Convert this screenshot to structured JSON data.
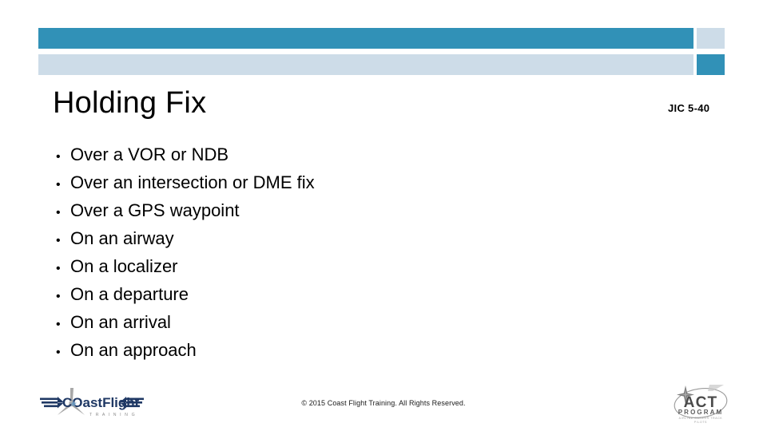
{
  "theme": {
    "teal": "#3191b7",
    "light_blue": "#cddce8",
    "text": "#000000",
    "logo_navy": "#1f3864",
    "logo_gray": "#808080"
  },
  "header": {
    "bars": [
      {
        "name": "teal-long-bar",
        "color": "#3191b7"
      },
      {
        "name": "light-square",
        "color": "#cddce8"
      },
      {
        "name": "light-long-bar",
        "color": "#cddce8"
      },
      {
        "name": "teal-square",
        "color": "#3191b7"
      }
    ]
  },
  "title": "Holding Fix",
  "slide_code": "JIC 5-40",
  "bullets": [
    {
      "marker": "•",
      "text": "Over a VOR or NDB"
    },
    {
      "marker": "•",
      "text": "Over an intersection or DME fix"
    },
    {
      "marker": "•",
      "text": "Over a GPS waypoint"
    },
    {
      "marker": "•",
      "text": "On an airway"
    },
    {
      "marker": "•",
      "text": "On a localizer"
    },
    {
      "marker": "•",
      "text": "On a departure"
    },
    {
      "marker": "•",
      "text": "On an arrival"
    },
    {
      "marker": "•",
      "text": "On an approach"
    }
  ],
  "footer": {
    "copyright": "© 2015 Coast Flight Training. All Rights Reserved."
  },
  "logos": {
    "coastflight": {
      "name": "coastflight-logo",
      "wordmark_coast": "COast",
      "wordmark_flight": "Flight",
      "tagline": "T R A I N I N G"
    },
    "act": {
      "name": "act-program-logo",
      "wordmark": "ACT",
      "subtitle": "PROGRAM",
      "tagline_line1": "AIRLINE CAREER TRACK",
      "tagline_line2": "PILOTS"
    }
  }
}
